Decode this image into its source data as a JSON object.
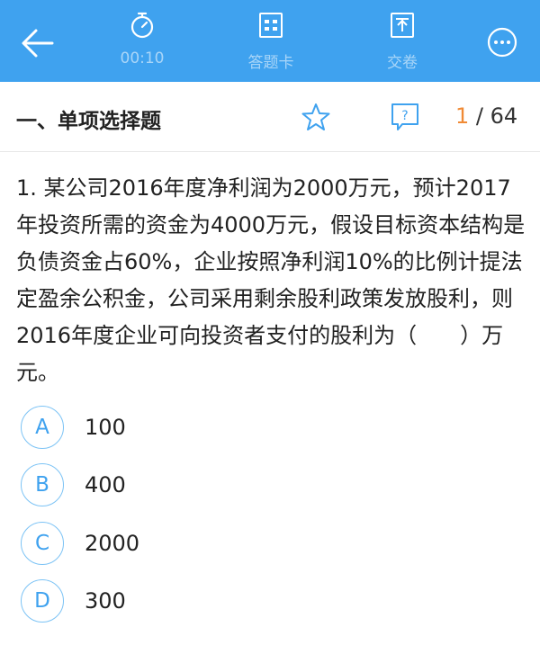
{
  "header": {
    "timer_label": "00:10",
    "answer_card_label": "答题卡",
    "submit_label": "交卷",
    "bg_color": "#3fa2ef"
  },
  "section": {
    "title": "一、单项选择题",
    "progress_current": "1",
    "progress_sep": " / ",
    "progress_total": "64"
  },
  "question": {
    "text": "1. 某公司2016年度净利润为2000万元，预计2017年投资所需的资金为4000万元，假设目标资本结构是负债资金占60%，企业按照净利润10%的比例计提法定盈余公积金，公司采用剩余股利政策发放股利，则2016年度企业可向投资者支付的股利为（　　）万元。"
  },
  "options": [
    {
      "letter": "A",
      "text": "100"
    },
    {
      "letter": "B",
      "text": "400"
    },
    {
      "letter": "C",
      "text": "2000"
    },
    {
      "letter": "D",
      "text": "300"
    }
  ],
  "icons": {
    "back": "back-arrow-icon",
    "timer": "stopwatch-icon",
    "answer_card": "answer-card-icon",
    "submit": "submit-icon",
    "more": "more-icon",
    "favorite": "star-icon",
    "feedback": "question-bubble-icon"
  }
}
